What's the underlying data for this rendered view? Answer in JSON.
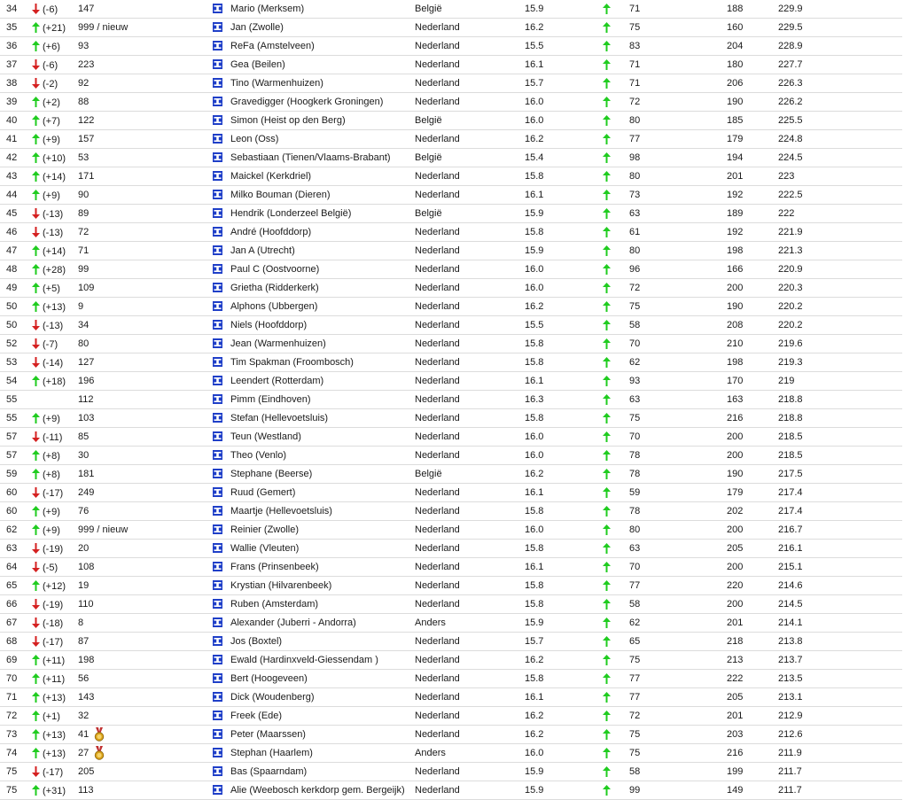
{
  "colors": {
    "up": "#20cc20",
    "down": "#d42020",
    "flag_blue": "#1f3fc8",
    "medal_gold": "#d9a21a"
  },
  "rows": [
    {
      "rank": "34",
      "dir": "down",
      "move": "(-6)",
      "prev": "147",
      "name": "Mario (Merksem)",
      "country": "België",
      "avg": "15.9",
      "a": "71",
      "b": "188",
      "score": "229.9"
    },
    {
      "rank": "35",
      "dir": "up",
      "move": "(+21)",
      "prev": "999 / nieuw",
      "name": "Jan (Zwolle)",
      "country": "Nederland",
      "avg": "16.2",
      "a": "75",
      "b": "160",
      "score": "229.5"
    },
    {
      "rank": "36",
      "dir": "up",
      "move": "(+6)",
      "prev": "93",
      "name": "ReFa (Amstelveen)",
      "country": "Nederland",
      "avg": "15.5",
      "a": "83",
      "b": "204",
      "score": "228.9"
    },
    {
      "rank": "37",
      "dir": "down",
      "move": "(-6)",
      "prev": "223",
      "name": "Gea (Beilen)",
      "country": "Nederland",
      "avg": "16.1",
      "a": "71",
      "b": "180",
      "score": "227.7"
    },
    {
      "rank": "38",
      "dir": "down",
      "move": "(-2)",
      "prev": "92",
      "name": "Tino (Warmenhuizen)",
      "country": "Nederland",
      "avg": "15.7",
      "a": "71",
      "b": "206",
      "score": "226.3"
    },
    {
      "rank": "39",
      "dir": "up",
      "move": "(+2)",
      "prev": "88",
      "name": "Gravedigger (Hoogkerk Groningen)",
      "country": "Nederland",
      "avg": "16.0",
      "a": "72",
      "b": "190",
      "score": "226.2"
    },
    {
      "rank": "40",
      "dir": "up",
      "move": "(+7)",
      "prev": "122",
      "name": "Simon (Heist op den Berg)",
      "country": "België",
      "avg": "16.0",
      "a": "80",
      "b": "185",
      "score": "225.5"
    },
    {
      "rank": "41",
      "dir": "up",
      "move": "(+9)",
      "prev": "157",
      "name": "Leon (Oss)",
      "country": "Nederland",
      "avg": "16.2",
      "a": "77",
      "b": "179",
      "score": "224.8"
    },
    {
      "rank": "42",
      "dir": "up",
      "move": "(+10)",
      "prev": "53",
      "name": "Sebastiaan (Tienen/Vlaams-Brabant)",
      "country": "België",
      "avg": "15.4",
      "a": "98",
      "b": "194",
      "score": "224.5"
    },
    {
      "rank": "43",
      "dir": "up",
      "move": "(+14)",
      "prev": "171",
      "name": "Maickel (Kerkdriel)",
      "country": "Nederland",
      "avg": "15.8",
      "a": "80",
      "b": "201",
      "score": "223"
    },
    {
      "rank": "44",
      "dir": "up",
      "move": "(+9)",
      "prev": "90",
      "name": "Milko Bouman (Dieren)",
      "country": "Nederland",
      "avg": "16.1",
      "a": "73",
      "b": "192",
      "score": "222.5"
    },
    {
      "rank": "45",
      "dir": "down",
      "move": "(-13)",
      "prev": "89",
      "name": "Hendrik (Londerzeel België)",
      "country": "België",
      "avg": "15.9",
      "a": "63",
      "b": "189",
      "score": "222"
    },
    {
      "rank": "46",
      "dir": "down",
      "move": "(-13)",
      "prev": "72",
      "name": "André (Hoofddorp)",
      "country": "Nederland",
      "avg": "15.8",
      "a": "61",
      "b": "192",
      "score": "221.9"
    },
    {
      "rank": "47",
      "dir": "up",
      "move": "(+14)",
      "prev": "71",
      "name": "Jan A (Utrecht)",
      "country": "Nederland",
      "avg": "15.9",
      "a": "80",
      "b": "198",
      "score": "221.3"
    },
    {
      "rank": "48",
      "dir": "up",
      "move": "(+28)",
      "prev": "99",
      "name": "Paul C (Oostvoorne)",
      "country": "Nederland",
      "avg": "16.0",
      "a": "96",
      "b": "166",
      "score": "220.9"
    },
    {
      "rank": "49",
      "dir": "up",
      "move": "(+5)",
      "prev": "109",
      "name": "Grietha (Ridderkerk)",
      "country": "Nederland",
      "avg": "16.0",
      "a": "72",
      "b": "200",
      "score": "220.3"
    },
    {
      "rank": "50",
      "dir": "up",
      "move": "(+13)",
      "prev": "9",
      "name": "Alphons (Ubbergen)",
      "country": "Nederland",
      "avg": "16.2",
      "a": "75",
      "b": "190",
      "score": "220.2"
    },
    {
      "rank": "50",
      "dir": "down",
      "move": "(-13)",
      "prev": "34",
      "name": "Niels (Hoofddorp)",
      "country": "Nederland",
      "avg": "15.5",
      "a": "58",
      "b": "208",
      "score": "220.2"
    },
    {
      "rank": "52",
      "dir": "down",
      "move": "(-7)",
      "prev": "80",
      "name": "Jean (Warmenhuizen)",
      "country": "Nederland",
      "avg": "15.8",
      "a": "70",
      "b": "210",
      "score": "219.6"
    },
    {
      "rank": "53",
      "dir": "down",
      "move": "(-14)",
      "prev": "127",
      "name": "Tim Spakman (Froombosch)",
      "country": "Nederland",
      "avg": "15.8",
      "a": "62",
      "b": "198",
      "score": "219.3"
    },
    {
      "rank": "54",
      "dir": "up",
      "move": "(+18)",
      "prev": "196",
      "name": "Leendert (Rotterdam)",
      "country": "Nederland",
      "avg": "16.1",
      "a": "93",
      "b": "170",
      "score": "219"
    },
    {
      "rank": "55",
      "dir": "none",
      "move": "",
      "prev": "112",
      "name": "Pimm (Eindhoven)",
      "country": "Nederland",
      "avg": "16.3",
      "a": "63",
      "b": "163",
      "score": "218.8"
    },
    {
      "rank": "55",
      "dir": "up",
      "move": "(+9)",
      "prev": "103",
      "name": "Stefan (Hellevoetsluis)",
      "country": "Nederland",
      "avg": "15.8",
      "a": "75",
      "b": "216",
      "score": "218.8"
    },
    {
      "rank": "57",
      "dir": "down",
      "move": "(-11)",
      "prev": "85",
      "name": "Teun (Westland)",
      "country": "Nederland",
      "avg": "16.0",
      "a": "70",
      "b": "200",
      "score": "218.5"
    },
    {
      "rank": "57",
      "dir": "up",
      "move": "(+8)",
      "prev": "30",
      "name": "Theo (Venlo)",
      "country": "Nederland",
      "avg": "16.0",
      "a": "78",
      "b": "200",
      "score": "218.5"
    },
    {
      "rank": "59",
      "dir": "up",
      "move": "(+8)",
      "prev": "181",
      "name": "Stephane (Beerse)",
      "country": "België",
      "avg": "16.2",
      "a": "78",
      "b": "190",
      "score": "217.5"
    },
    {
      "rank": "60",
      "dir": "down",
      "move": "(-17)",
      "prev": "249",
      "name": "Ruud (Gemert)",
      "country": "Nederland",
      "avg": "16.1",
      "a": "59",
      "b": "179",
      "score": "217.4"
    },
    {
      "rank": "60",
      "dir": "up",
      "move": "(+9)",
      "prev": "76",
      "name": "Maartje (Hellevoetsluis)",
      "country": "Nederland",
      "avg": "15.8",
      "a": "78",
      "b": "202",
      "score": "217.4"
    },
    {
      "rank": "62",
      "dir": "up",
      "move": "(+9)",
      "prev": "999 / nieuw",
      "name": "Reinier (Zwolle)",
      "country": "Nederland",
      "avg": "16.0",
      "a": "80",
      "b": "200",
      "score": "216.7"
    },
    {
      "rank": "63",
      "dir": "down",
      "move": "(-19)",
      "prev": "20",
      "name": "Wallie (Vleuten)",
      "country": "Nederland",
      "avg": "15.8",
      "a": "63",
      "b": "205",
      "score": "216.1"
    },
    {
      "rank": "64",
      "dir": "down",
      "move": "(-5)",
      "prev": "108",
      "name": "Frans (Prinsenbeek)",
      "country": "Nederland",
      "avg": "16.1",
      "a": "70",
      "b": "200",
      "score": "215.1"
    },
    {
      "rank": "65",
      "dir": "up",
      "move": "(+12)",
      "prev": "19",
      "name": "Krystian (Hilvarenbeek)",
      "country": "Nederland",
      "avg": "15.8",
      "a": "77",
      "b": "220",
      "score": "214.6"
    },
    {
      "rank": "66",
      "dir": "down",
      "move": "(-19)",
      "prev": "110",
      "name": "Ruben (Amsterdam)",
      "country": "Nederland",
      "avg": "15.8",
      "a": "58",
      "b": "200",
      "score": "214.5"
    },
    {
      "rank": "67",
      "dir": "down",
      "move": "(-18)",
      "prev": "8",
      "name": "Alexander (Juberri - Andorra)",
      "country": "Anders",
      "avg": "15.9",
      "a": "62",
      "b": "201",
      "score": "214.1"
    },
    {
      "rank": "68",
      "dir": "down",
      "move": "(-17)",
      "prev": "87",
      "name": "Jos (Boxtel)",
      "country": "Nederland",
      "avg": "15.7",
      "a": "65",
      "b": "218",
      "score": "213.8"
    },
    {
      "rank": "69",
      "dir": "up",
      "move": "(+11)",
      "prev": "198",
      "name": "Ewald (Hardinxveld-Giessendam )",
      "country": "Nederland",
      "avg": "16.2",
      "a": "75",
      "b": "213",
      "score": "213.7"
    },
    {
      "rank": "70",
      "dir": "up",
      "move": "(+11)",
      "prev": "56",
      "name": "Bert (Hoogeveen)",
      "country": "Nederland",
      "avg": "15.8",
      "a": "77",
      "b": "222",
      "score": "213.5"
    },
    {
      "rank": "71",
      "dir": "up",
      "move": "(+13)",
      "prev": "143",
      "name": "Dick (Woudenberg)",
      "country": "Nederland",
      "avg": "16.1",
      "a": "77",
      "b": "205",
      "score": "213.1"
    },
    {
      "rank": "72",
      "dir": "up",
      "move": "(+1)",
      "prev": "32",
      "name": "Freek (Ede)",
      "country": "Nederland",
      "avg": "16.2",
      "a": "72",
      "b": "201",
      "score": "212.9"
    },
    {
      "rank": "73",
      "dir": "up",
      "move": "(+13)",
      "prev": "41",
      "medal": true,
      "name": "Peter (Maarssen)",
      "country": "Nederland",
      "avg": "16.2",
      "a": "75",
      "b": "203",
      "score": "212.6"
    },
    {
      "rank": "74",
      "dir": "up",
      "move": "(+13)",
      "prev": "27",
      "medal": true,
      "name": "Stephan (Haarlem)",
      "country": "Anders",
      "avg": "16.0",
      "a": "75",
      "b": "216",
      "score": "211.9"
    },
    {
      "rank": "75",
      "dir": "down",
      "move": "(-17)",
      "prev": "205",
      "name": "Bas (Spaarndam)",
      "country": "Nederland",
      "avg": "15.9",
      "a": "58",
      "b": "199",
      "score": "211.7"
    },
    {
      "rank": "75",
      "dir": "up",
      "move": "(+31)",
      "prev": "113",
      "name": "Alie (Weebosch kerkdorp gem. Bergeijk)",
      "country": "Nederland",
      "avg": "15.9",
      "a": "99",
      "b": "149",
      "score": "211.7"
    }
  ]
}
